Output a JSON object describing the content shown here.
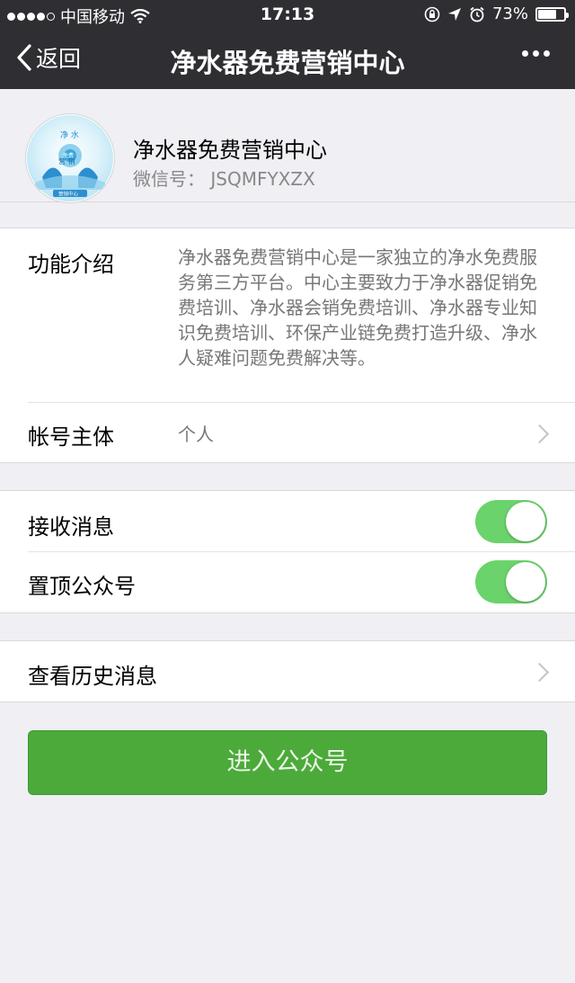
{
  "status_bar": {
    "carrier": "中国移动",
    "time": "17:13",
    "battery_percent": "73%",
    "battery_level": 0.73,
    "icons": [
      "signal-dots-icon",
      "wifi-icon",
      "orientation-lock-icon",
      "location-arrow-icon",
      "alarm-icon",
      "battery-icon"
    ]
  },
  "nav": {
    "back_label": "返回",
    "title": "净水器免费营销中心",
    "more_icon": "more-dots-icon"
  },
  "profile": {
    "name": "净水器免费营销中心",
    "wechat_id": "微信号： JSQMFYXZX",
    "avatar_text": {
      "line1": "净  水",
      "line2": "营  销",
      "line3": "免费",
      "bottom": "营销中心"
    }
  },
  "info": {
    "intro_label": "功能介绍",
    "intro_text": "净水器免费营销中心是一家独立的净水免费服务第三方平台。中心主要致力于净水器促销免费培训、净水器会销免费培训、净水器专业知识免费培训、环保产业链免费打造升级、净水人疑难问题免费解决等。",
    "account_label": "帐号主体",
    "account_value": "个人"
  },
  "settings": {
    "receive_label": "接收消息",
    "receive_on": true,
    "pin_label": "置顶公众号",
    "pin_on": true
  },
  "history": {
    "label": "查看历史消息"
  },
  "actions": {
    "enter_label": "进入公众号"
  },
  "colors": {
    "header_bg": "#2f2f33",
    "toggle_on": "#6bd36c",
    "button_green": "#4caa3a",
    "page_bg": "#efeff4"
  }
}
